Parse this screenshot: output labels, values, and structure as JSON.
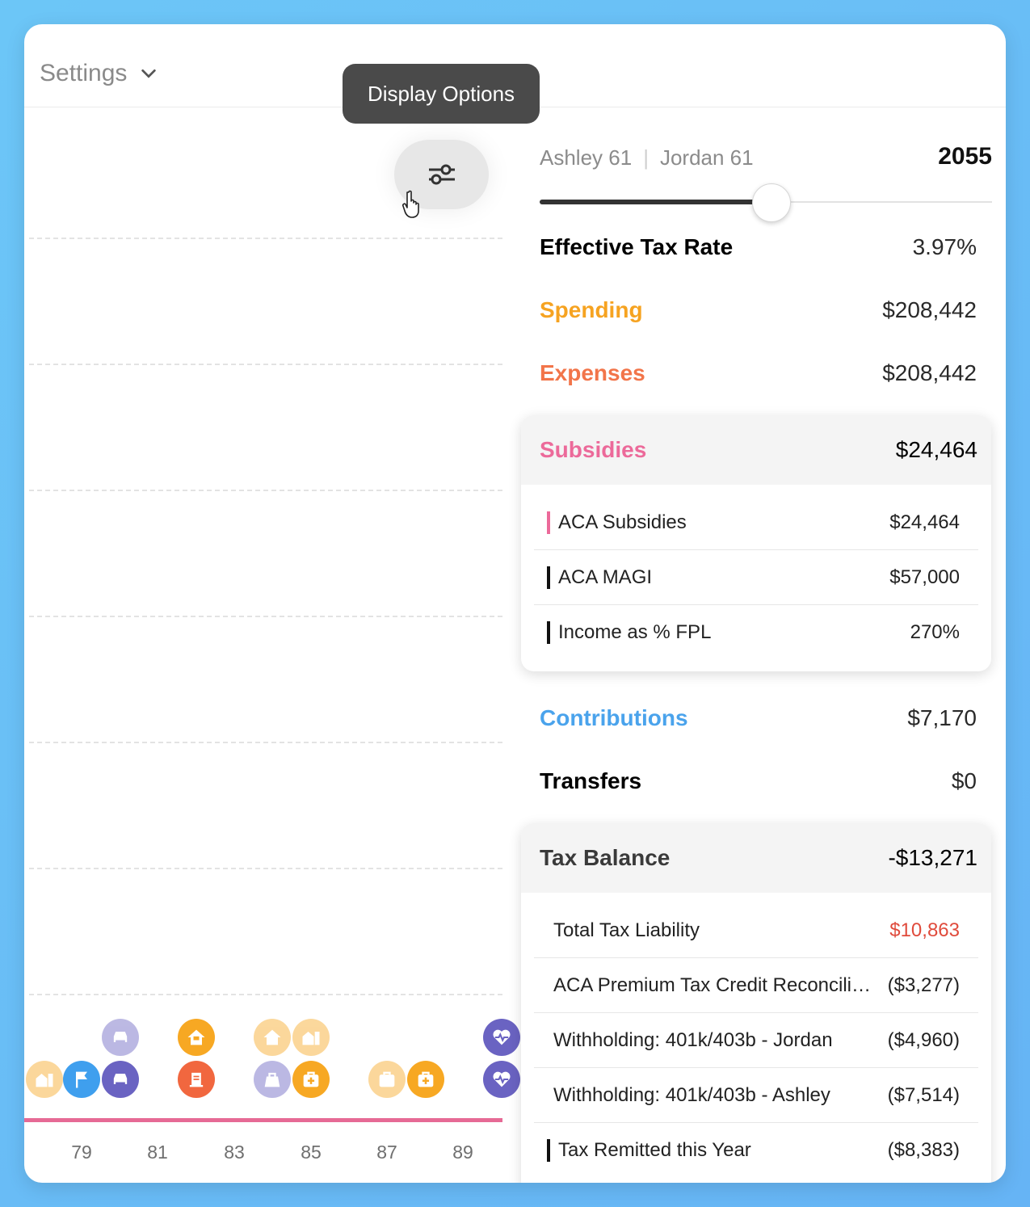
{
  "header": {
    "settings_label": "Settings",
    "tooltip": "Display Options"
  },
  "chart": {
    "x_ticks": [
      "79",
      "81",
      "83",
      "85",
      "87",
      "89"
    ],
    "accent_line_color": "#e66a95"
  },
  "summary": {
    "person1": "Ashley 61",
    "person2": "Jordan 61",
    "year": "2055",
    "slider_fraction": 0.51,
    "rows": [
      {
        "label": "Effective Tax Rate",
        "value": "3.97%",
        "color": "#111111"
      },
      {
        "label": "Spending",
        "value": "$208,442",
        "color": "#f6a321"
      },
      {
        "label": "Expenses",
        "value": "$208,442",
        "color": "#f2754a"
      }
    ],
    "subsidies": {
      "label": "Subsidies",
      "value": "$24,464",
      "color": "#ec6a9a",
      "items": [
        {
          "label": "ACA Subsidies",
          "value": "$24,464",
          "bar": "#ec6a9a"
        },
        {
          "label": "ACA MAGI",
          "value": "$57,000",
          "bar": "#111111"
        },
        {
          "label": "Income as % FPL",
          "value": "270%",
          "bar": "#111111"
        }
      ]
    },
    "rows2": [
      {
        "label": "Contributions",
        "value": "$7,170",
        "color": "#4aa3ec"
      },
      {
        "label": "Transfers",
        "value": "$0",
        "color": "#111111"
      }
    ],
    "tax_balance": {
      "label": "Tax Balance",
      "value": "-$13,271",
      "items": [
        {
          "label": "Total Tax Liability",
          "value": "$10,863",
          "value_color": "#e04b3c"
        },
        {
          "label": "ACA Premium Tax Credit Reconciliation",
          "value": "($3,277)"
        },
        {
          "label": "Withholding: 401k/403b - Jordan",
          "value": "($4,960)"
        },
        {
          "label": "Withholding: 401k/403b - Ashley",
          "value": "($7,514)"
        },
        {
          "label": "Tax Remitted this Year",
          "value": "($8,383)",
          "bar": "#111111"
        }
      ]
    }
  },
  "icons": {
    "colors": {
      "orange": "#f7a823",
      "red": "#f1673f",
      "purple": "#6a63c2",
      "blue": "#3f9fee"
    }
  }
}
